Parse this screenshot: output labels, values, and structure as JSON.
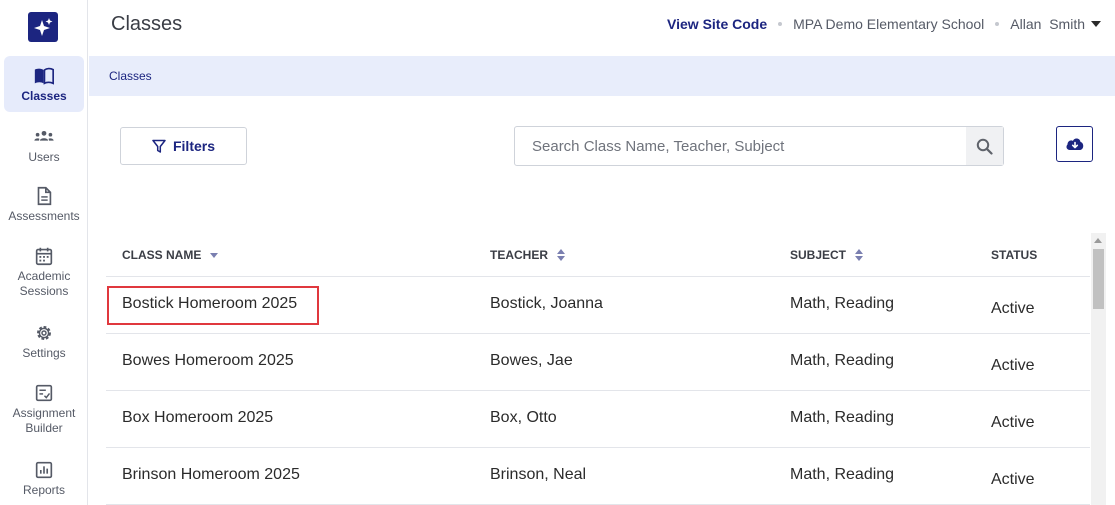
{
  "sidebar": {
    "logo": "sparkle-logo-icon",
    "items": [
      {
        "label": "Classes",
        "icon": "book-open-icon",
        "active": true
      },
      {
        "label": "Users",
        "icon": "users-group-icon",
        "active": false
      },
      {
        "label": "Assessments",
        "icon": "document-icon",
        "active": false
      },
      {
        "label": "Academic Sessions",
        "icon": "calendar-icon",
        "active": false
      },
      {
        "label": "Settings",
        "icon": "gear-icon",
        "active": false
      },
      {
        "label": "Assignment Builder",
        "icon": "checklist-icon",
        "active": false
      },
      {
        "label": "Reports",
        "icon": "bar-chart-icon",
        "active": false
      }
    ]
  },
  "header": {
    "title": "Classes",
    "site_code_label": "View Site Code",
    "school": "MPA Demo Elementary School",
    "user": "Allan  Smith"
  },
  "breadcrumb": "Classes",
  "toolbar": {
    "filters_label": "Filters",
    "search_placeholder": "Search Class Name, Teacher, Subject",
    "search_icon": "search-icon",
    "download_icon": "cloud-download-icon"
  },
  "table": {
    "columns": [
      "CLASS NAME",
      "TEACHER",
      "SUBJECT",
      "STATUS"
    ],
    "rows": [
      {
        "class_name": "Bostick Homeroom 2025",
        "teacher": "Bostick, Joanna",
        "subject": "Math, Reading",
        "status": "Active"
      },
      {
        "class_name": "Bowes Homeroom 2025",
        "teacher": "Bowes, Jae",
        "subject": "Math, Reading",
        "status": "Active"
      },
      {
        "class_name": "Box Homeroom 2025",
        "teacher": "Box, Otto",
        "subject": "Math, Reading",
        "status": "Active"
      },
      {
        "class_name": "Brinson Homeroom 2025",
        "teacher": "Brinson, Neal",
        "subject": "Math, Reading",
        "status": "Active"
      }
    ]
  },
  "colors": {
    "brand": "#1c2580",
    "active_bg": "#e6ebfb",
    "highlight": "#e0383e"
  }
}
